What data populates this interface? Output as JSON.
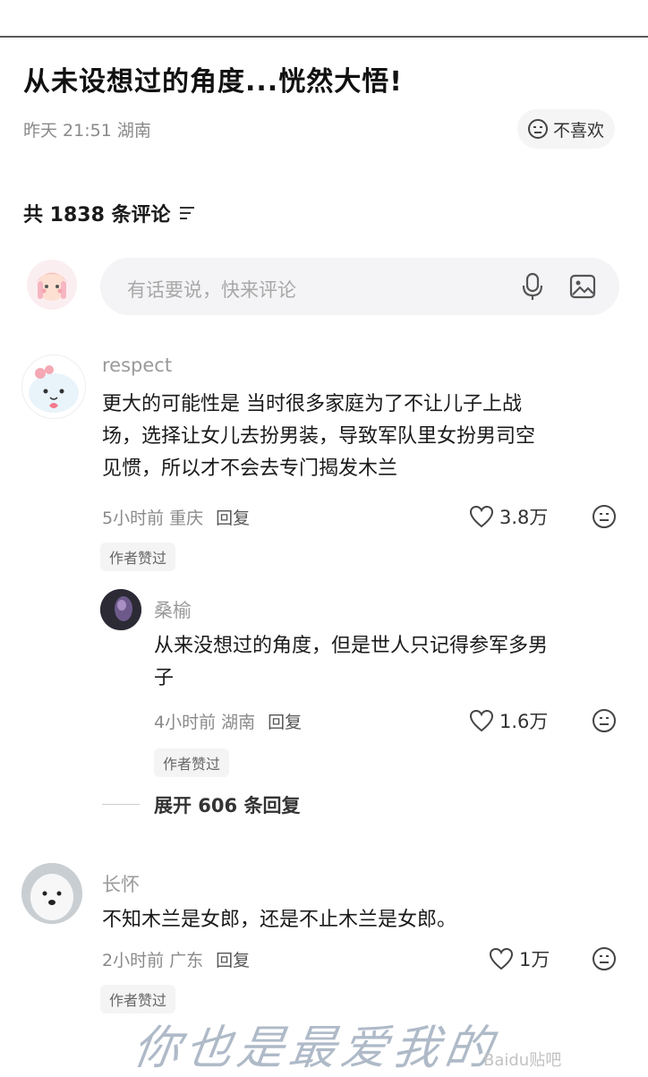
{
  "post": {
    "title": "从未设想过的角度...恍然大悟!",
    "meta": "昨天 21:51 湖南",
    "dislike_label": "不喜欢"
  },
  "comments_header": {
    "count_text": "共 1838 条评论"
  },
  "comment_input": {
    "placeholder": "有话要说，快来评论"
  },
  "comments": [
    {
      "username": "respect",
      "lines": [
        "更大的可能性是  当时很多家庭为了不让儿子上战",
        "场，选择让女儿去扮男装，导致军队里女扮男司空",
        "见惯，所以才不会去专门揭发木兰"
      ],
      "time_location": "5小时前 重庆",
      "reply_label": "回复",
      "likes": "3.8万",
      "badge": "作者赞过",
      "replies": [
        {
          "username": "桑榆",
          "lines": [
            "从来没想过的角度，但是世人只记得参军多男",
            "子"
          ],
          "time_location": "4小时前 湖南",
          "reply_label": "回复",
          "likes": "1.6万",
          "badge": "作者赞过"
        }
      ],
      "expand_label": "展开 606 条回复"
    },
    {
      "username": "长怀",
      "lines": [
        "不知木兰是女郎，还是不止木兰是女郎。"
      ],
      "time_location": "2小时前 广东",
      "reply_label": "回复",
      "likes": "1万",
      "badge": "作者赞过"
    }
  ],
  "overlay": {
    "handwriting": "你也是最爱我的",
    "watermark": "Baidu贴吧"
  },
  "icons": {
    "dislike": "neutral-face-icon",
    "filter": "sort-lines-icon",
    "mic": "microphone-icon",
    "image": "image-icon",
    "like": "heart-outline-icon"
  }
}
